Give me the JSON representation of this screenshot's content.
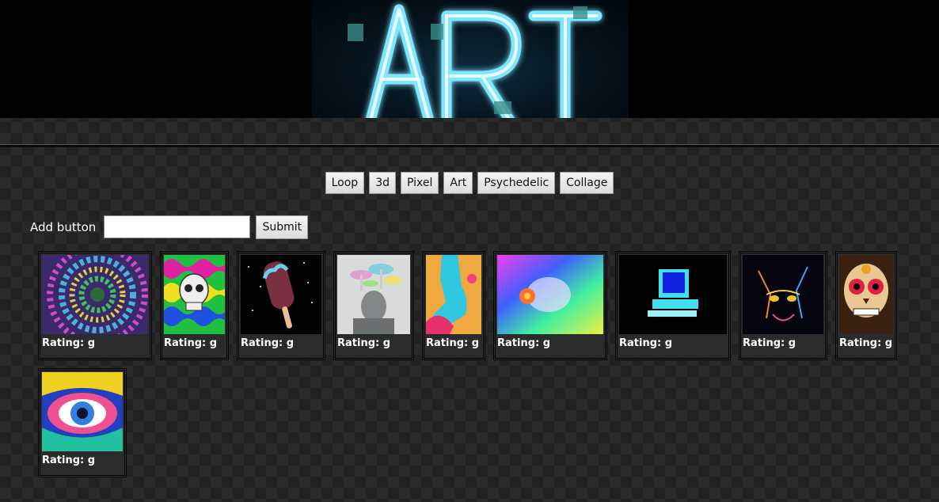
{
  "banner": {
    "logo_text": "ART"
  },
  "topics": [
    "Loop",
    "3d",
    "Pixel",
    "Art",
    "Psychedelic",
    "Collage"
  ],
  "add_form": {
    "label": "Add button",
    "input_value": "",
    "submit_label": "Submit"
  },
  "gifs": [
    {
      "rating": "Rating: g",
      "icon": "psychedelic-spiral-image"
    },
    {
      "rating": "Rating: g",
      "icon": "skull-waves-image"
    },
    {
      "rating": "Rating: g",
      "icon": "popsicle-space-image"
    },
    {
      "rating": "Rating: g",
      "icon": "mushroom-head-image"
    },
    {
      "rating": "Rating: g",
      "icon": "hand-pop-art-image"
    },
    {
      "rating": "Rating: g",
      "icon": "rainbow-dog-image"
    },
    {
      "rating": "Rating: g",
      "icon": "retro-computer-image"
    },
    {
      "rating": "Rating: g",
      "icon": "neon-cat-image"
    },
    {
      "rating": "Rating: g",
      "icon": "sugar-skull-image"
    },
    {
      "rating": "Rating: g",
      "icon": "psychedelic-eye-image"
    }
  ]
}
